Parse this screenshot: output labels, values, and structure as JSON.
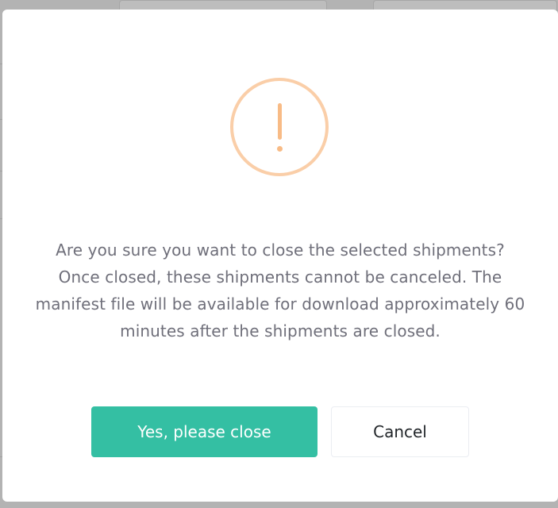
{
  "dialog": {
    "icon": "warning-exclamation-icon",
    "message": "Are you sure you want to close the selected shipments? Once closed, these shipments cannot be canceled. The manifest file will be available for download approximately 60 minutes after the shipments are closed.",
    "confirm_label": "Yes, please close",
    "cancel_label": "Cancel"
  },
  "colors": {
    "confirm_button": "#34bfa3",
    "warning_icon": "#f8bb86",
    "warning_ring": "#facea8",
    "message_text": "#6f6f7a"
  }
}
